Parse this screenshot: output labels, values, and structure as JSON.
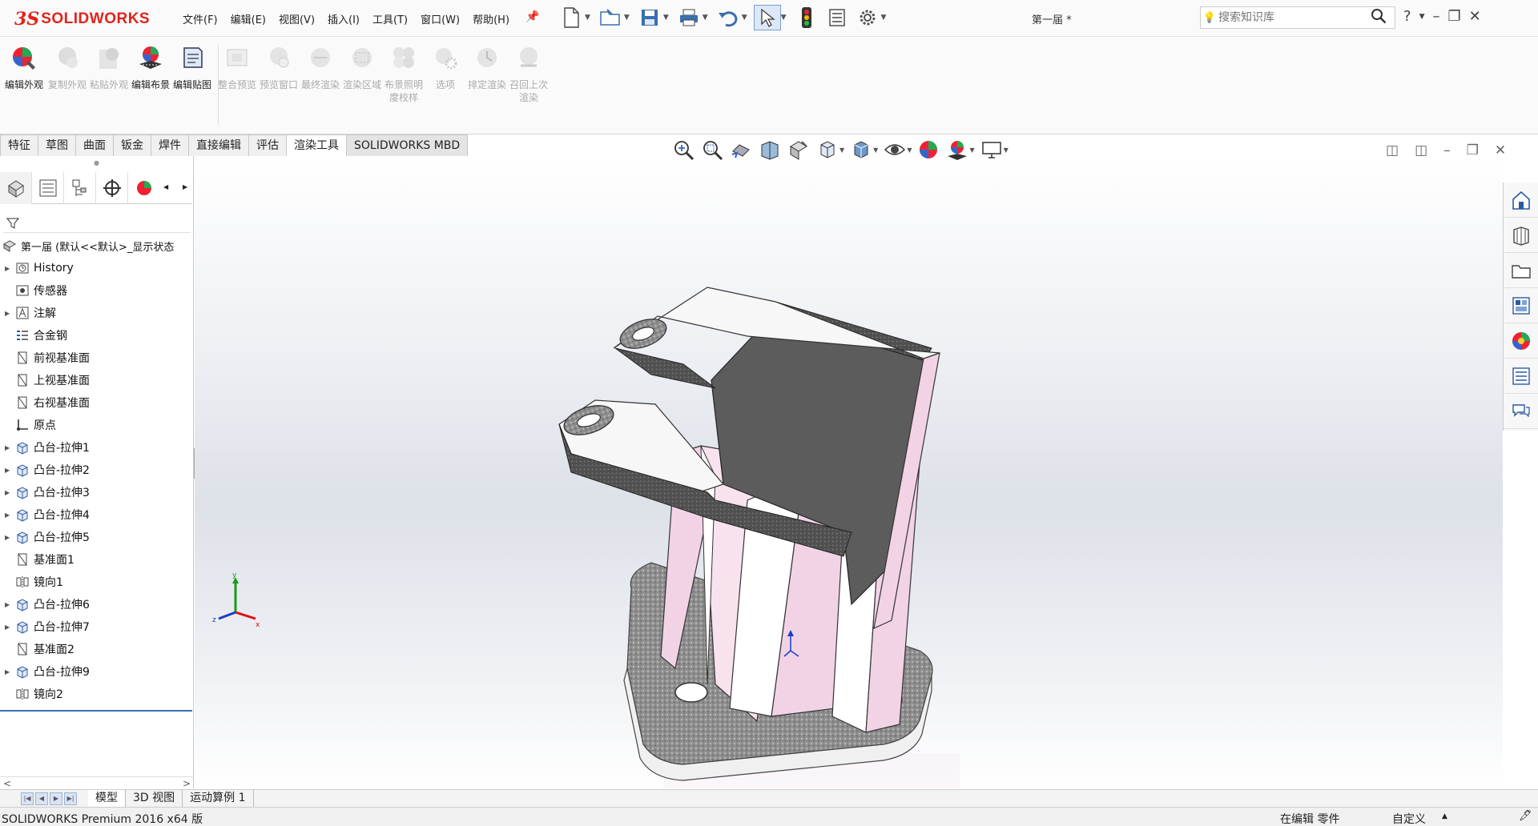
{
  "app": {
    "brand": "SOLIDWORKS",
    "document_title": "第一届 *"
  },
  "menu": [
    "文件(F)",
    "编辑(E)",
    "视图(V)",
    "插入(I)",
    "工具(T)",
    "窗口(W)",
    "帮助(H)"
  ],
  "search": {
    "placeholder": "搜索知识库"
  },
  "commands": {
    "active": [
      {
        "label": "编辑外观",
        "icon": "edit-appearance-icon"
      },
      {
        "label": "复制外观",
        "icon": "copy-appearance-icon"
      },
      {
        "label": "粘贴外观",
        "icon": "paste-appearance-icon"
      },
      {
        "label": "编辑布景",
        "icon": "edit-scene-icon"
      },
      {
        "label": "编辑贴图",
        "icon": "edit-decal-icon"
      }
    ],
    "disabled": [
      {
        "label": "整合预览",
        "icon": "integrated-preview-icon"
      },
      {
        "label": "预览窗口",
        "icon": "preview-window-icon"
      },
      {
        "label": "最终渲染",
        "icon": "final-render-icon"
      },
      {
        "label": "渲染区域",
        "icon": "render-region-icon"
      },
      {
        "label": "布景照明度校样",
        "icon": "scene-illumination-icon"
      },
      {
        "label": "选项",
        "icon": "options-icon"
      },
      {
        "label": "排定渲染",
        "icon": "schedule-render-icon"
      },
      {
        "label": "召回上次渲染",
        "icon": "recall-render-icon"
      }
    ]
  },
  "tabs": [
    "特征",
    "草图",
    "曲面",
    "钣金",
    "焊件",
    "直接编辑",
    "评估",
    "渲染工具",
    "SOLIDWORKS MBD"
  ],
  "active_tab": "渲染工具",
  "tree": {
    "root": "第一届 (默认<<默认>_显示状态",
    "items": [
      {
        "label": "History",
        "expandable": true,
        "icon": "history-icon"
      },
      {
        "label": "传感器",
        "expandable": false,
        "icon": "sensor-icon"
      },
      {
        "label": "注解",
        "expandable": true,
        "icon": "annotation-icon"
      },
      {
        "label": "合金钢",
        "expandable": false,
        "icon": "material-icon"
      },
      {
        "label": "前视基准面",
        "expandable": false,
        "icon": "plane-icon"
      },
      {
        "label": "上视基准面",
        "expandable": false,
        "icon": "plane-icon"
      },
      {
        "label": "右视基准面",
        "expandable": false,
        "icon": "plane-icon"
      },
      {
        "label": "原点",
        "expandable": false,
        "icon": "origin-icon"
      },
      {
        "label": "凸台-拉伸1",
        "expandable": true,
        "icon": "extrude-icon"
      },
      {
        "label": "凸台-拉伸2",
        "expandable": true,
        "icon": "extrude-icon"
      },
      {
        "label": "凸台-拉伸3",
        "expandable": true,
        "icon": "extrude-icon"
      },
      {
        "label": "凸台-拉伸4",
        "expandable": true,
        "icon": "extrude-icon"
      },
      {
        "label": "凸台-拉伸5",
        "expandable": true,
        "icon": "extrude-icon"
      },
      {
        "label": "基准面1",
        "expandable": false,
        "icon": "plane-icon"
      },
      {
        "label": "镜向1",
        "expandable": false,
        "icon": "mirror-icon"
      },
      {
        "label": "凸台-拉伸6",
        "expandable": true,
        "icon": "extrude-icon"
      },
      {
        "label": "凸台-拉伸7",
        "expandable": true,
        "icon": "extrude-icon"
      },
      {
        "label": "基准面2",
        "expandable": false,
        "icon": "plane-icon"
      },
      {
        "label": "凸台-拉伸9",
        "expandable": true,
        "icon": "extrude-icon"
      },
      {
        "label": "镜向2",
        "expandable": false,
        "icon": "mirror-icon"
      }
    ]
  },
  "triad": {
    "x": "x",
    "y": "y",
    "z": "z"
  },
  "bottom_tabs": [
    "模型",
    "3D 视图",
    "运动算例 1"
  ],
  "status": {
    "product": "SOLIDWORKS Premium 2016 x64 版",
    "mode": "在编辑 零件",
    "units": "自定义"
  },
  "colors": {
    "brand": "#e2231a",
    "selection_blue": "#3d6fba",
    "part_pink": "#f2d3e6",
    "part_dark": "#5a5a5a",
    "part_metal": "#a9a9a9"
  }
}
